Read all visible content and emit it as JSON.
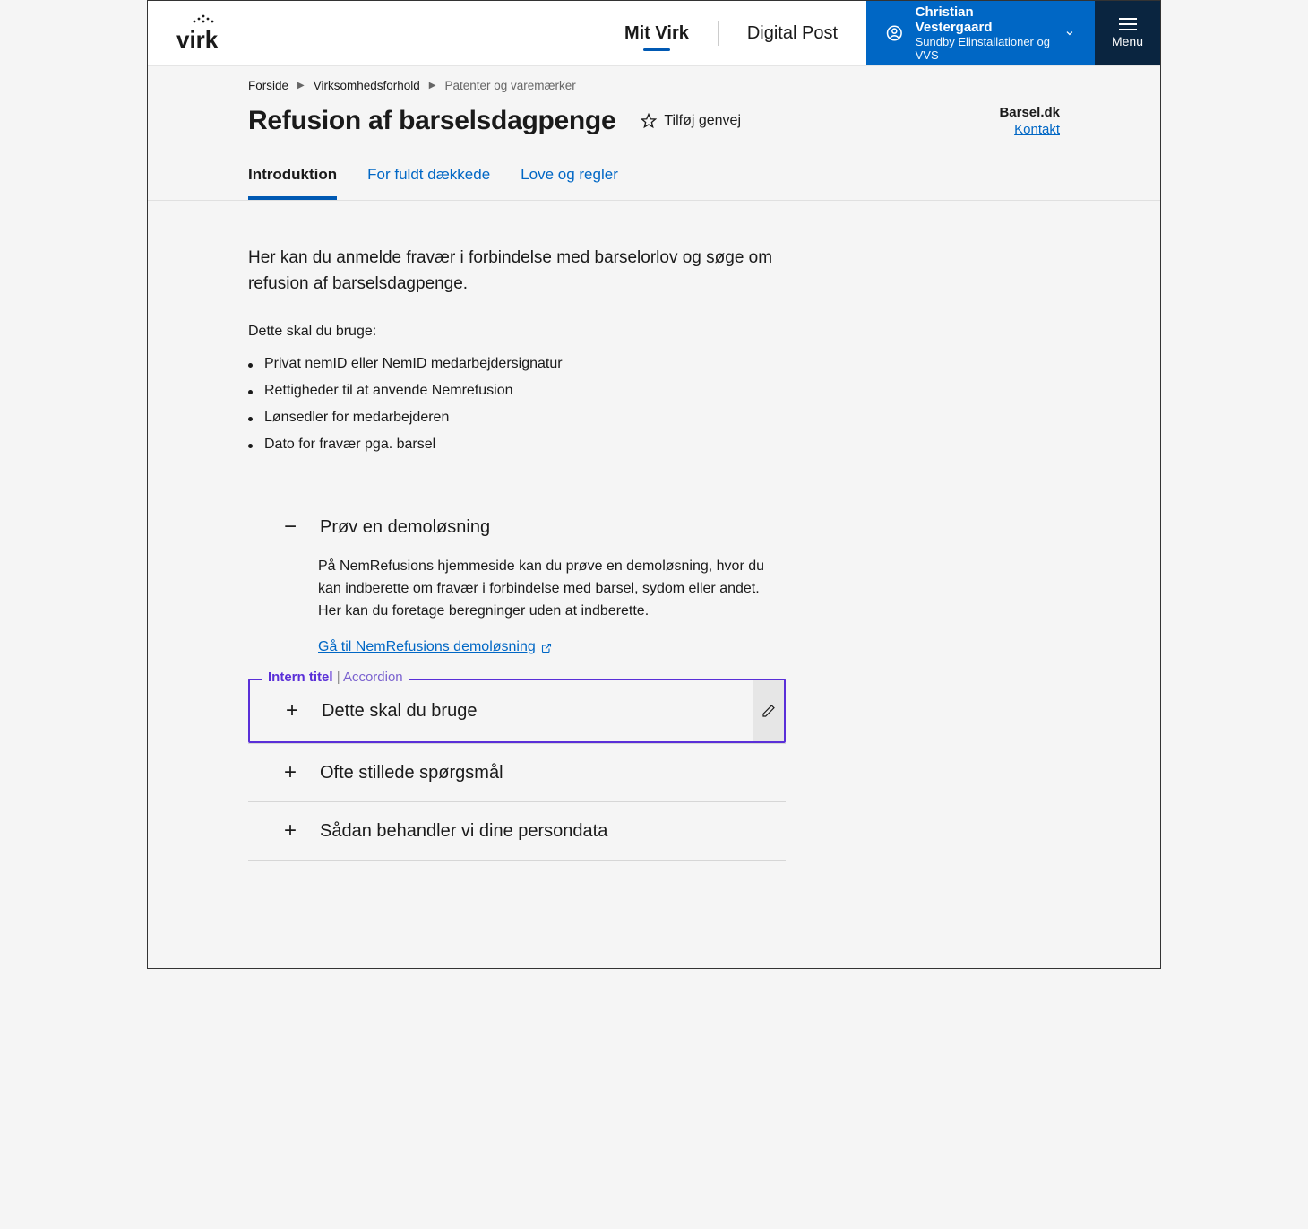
{
  "header": {
    "nav": {
      "mit_virk": "Mit Virk",
      "digital_post": "Digital Post"
    },
    "user": {
      "name": "Christian Vestergaard",
      "org": "Sundby Elinstallationer og VVS"
    },
    "menu_label": "Menu"
  },
  "breadcrumb": {
    "items": [
      {
        "label": "Forside",
        "link": true
      },
      {
        "label": "Virksomhedsforhold",
        "link": true
      },
      {
        "label": "Patenter og varemærker",
        "link": false
      }
    ]
  },
  "page": {
    "title": "Refusion af barselsdagpenge",
    "shortcut_label": "Tilføj genvej",
    "org_name": "Barsel.dk",
    "contact_label": "Kontakt"
  },
  "tabs": [
    {
      "label": "Introduktion",
      "active": true
    },
    {
      "label": "For fuldt dækkede",
      "active": false
    },
    {
      "label": "Love og regler",
      "active": false
    }
  ],
  "intro": {
    "lead": "Her kan du anmelde fravær i forbindelse med barselorlov og søge om refusion af barselsdagpenge.",
    "need_label": "Dette skal du bruge:",
    "need_items": [
      "Privat nemID eller NemID medarbejdersignatur",
      "Rettigheder til at anvende Nemrefusion",
      "Lønsedler for medarbejderen",
      "Dato for fravær pga. barsel"
    ]
  },
  "accordions": [
    {
      "title": "Prøv en demoløsning",
      "open": true,
      "body_text": "På NemRefusions hjemmeside kan du prøve en demoløsning, hvor du kan indberette om fravær i forbindelse med barsel, sydom eller andet. Her kan du foretage beregninger uden at indberette.",
      "link_text": "Gå til NemRefusions demoløsning"
    },
    {
      "title": "Dette skal du bruge",
      "open": false,
      "editor": {
        "label_a": "Intern titel",
        "label_b": "Accordion"
      }
    },
    {
      "title": "Ofte stillede spørgsmål",
      "open": false
    },
    {
      "title": "Sådan behandler vi dine persondata",
      "open": false
    }
  ]
}
